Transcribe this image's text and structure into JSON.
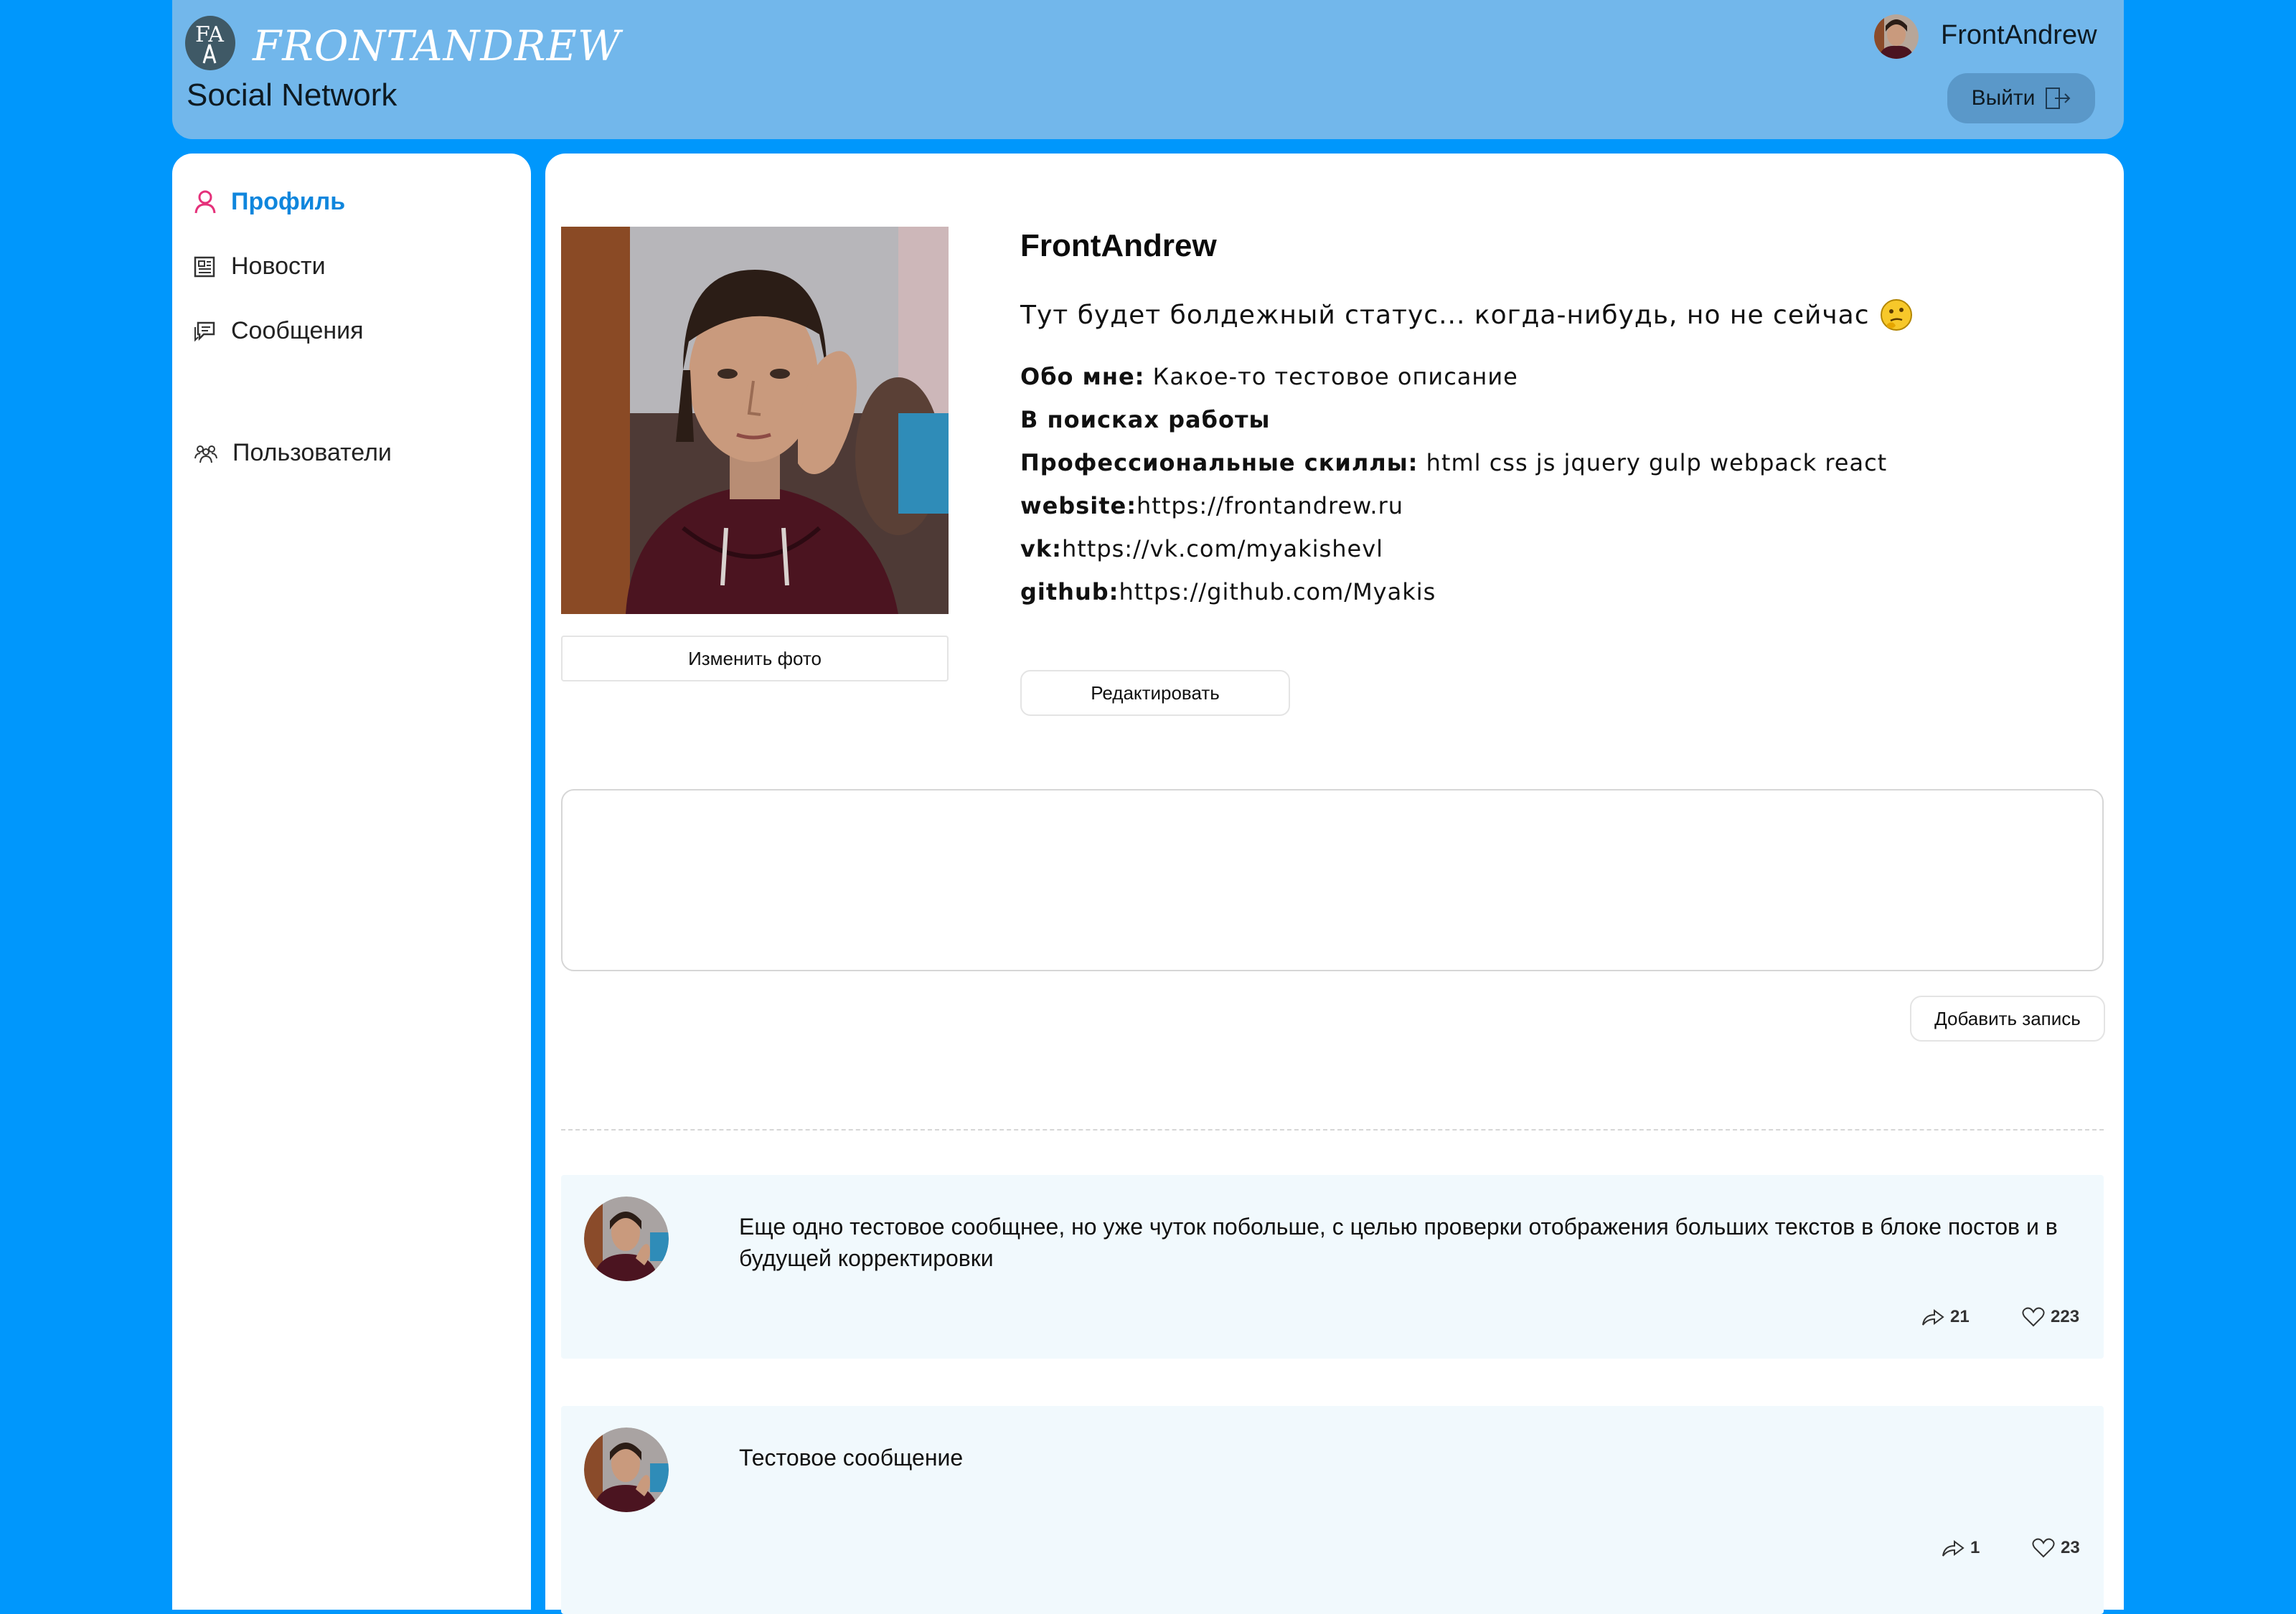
{
  "header": {
    "logo_mark": "FA",
    "logo_text": "FRONTANDREW",
    "brand_subtitle": "Social Network",
    "user_name": "FrontAndrew",
    "logout_label": "Выйти",
    "logout_icon": "logout-icon"
  },
  "sidebar": {
    "items": [
      {
        "label": "Профиль",
        "icon": "user-icon",
        "active": true
      },
      {
        "label": "Новости",
        "icon": "newspaper-icon",
        "active": false
      },
      {
        "label": "Сообщения",
        "icon": "chat-icon",
        "active": false
      },
      {
        "label": "Пользователи",
        "icon": "users-icon",
        "active": false
      }
    ]
  },
  "profile": {
    "change_photo_label": "Изменить фото",
    "name": "FrontAndrew",
    "status": "Тут будет болдежный статус... когда-нибудь, но не сейчас",
    "status_emoji": "thinking-face",
    "about_label": "Обо мне:",
    "about_value": "Какое-то тестовое описание",
    "job_search_label": "В поисках работы",
    "skills_label": "Профессиональные скиллы:",
    "skills_value": "html css js jquery gulp webpack react",
    "website_label": "website:",
    "website_value": "https://frontandrew.ru",
    "vk_label": "vk:",
    "vk_value": "https://vk.com/myakishevl",
    "github_label": "github:",
    "github_value": "https://github.com/Myakis",
    "edit_label": "Редактировать"
  },
  "new_post": {
    "textarea_value": "",
    "add_label": "Добавить запись"
  },
  "posts": [
    {
      "text": "Еще одно тестовое сообщнее, но уже чуток побольше, с целью проверки отображения больших текстов в блоке постов и в будущей корректировки",
      "shares": "21",
      "likes": "223"
    },
    {
      "text": "Тестовое сообщение",
      "shares": "1",
      "likes": "23"
    }
  ],
  "colors": {
    "page_bg": "#0097fc",
    "header_bg": "#72b7eb",
    "logout_bg": "#5a98c9",
    "active_nav": "#0f86dd",
    "active_icon": "#e5317a",
    "post_bg": "#f1f9fd"
  }
}
